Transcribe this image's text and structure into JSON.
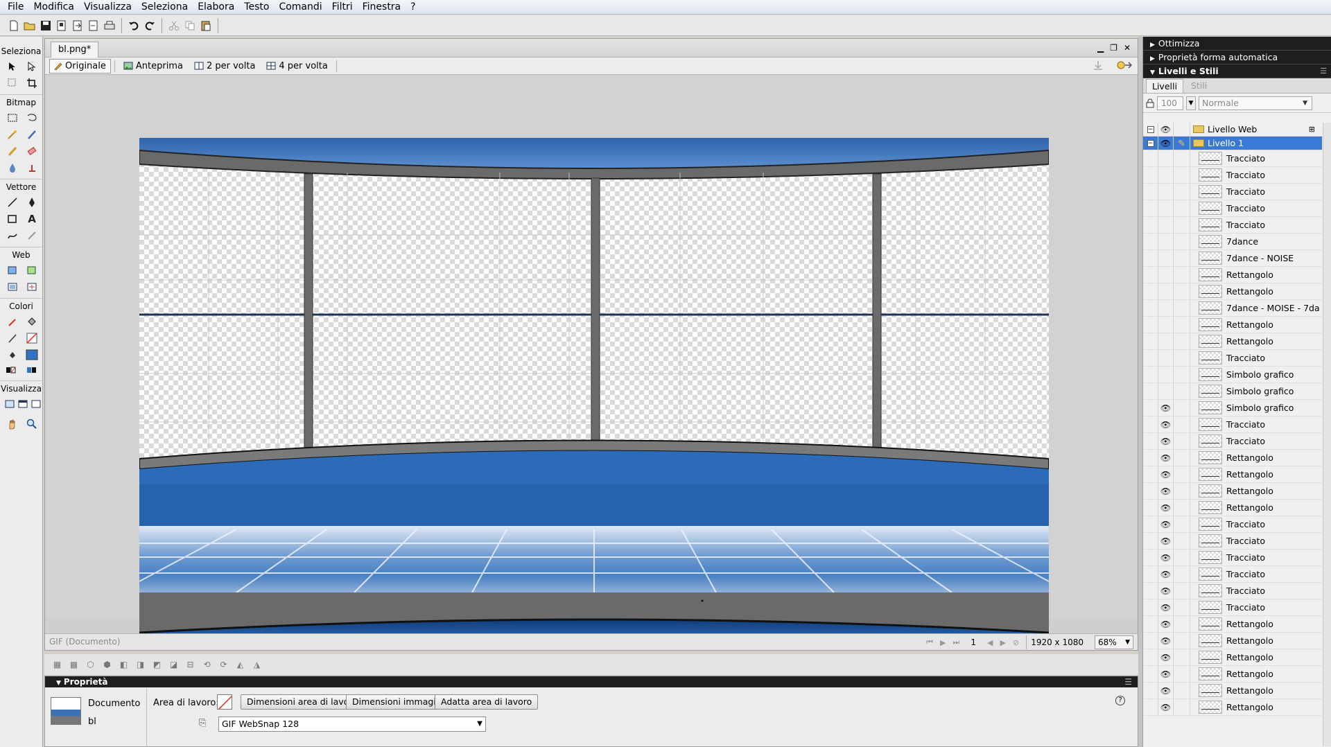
{
  "menu": [
    "File",
    "Modifica",
    "Visualizza",
    "Seleziona",
    "Elabora",
    "Testo",
    "Comandi",
    "Filtri",
    "Finestra",
    "?"
  ],
  "tools": {
    "sections": [
      "Seleziona",
      "Bitmap",
      "Vettore",
      "Web",
      "Colori",
      "Visualizza"
    ]
  },
  "document": {
    "tab_title": "bl.png*",
    "views": [
      "Originale",
      "Anteprima",
      "2 per volta",
      "4 per volta"
    ],
    "status_type": "GIF (Documento)",
    "frame": "1",
    "dimensions": "1920 x 1080",
    "zoom": "68%"
  },
  "properties": {
    "title": "Proprietà",
    "doc_label": "Documento",
    "doc_name": "bl",
    "canvas_label": "Area di lavoro:",
    "btn_canvas_size": "Dimensioni area di lavoro...",
    "btn_image_size": "Dimensioni immagine...",
    "btn_fit": "Adatta area di lavoro",
    "palette": "GIF WebSnap 128"
  },
  "panels": {
    "ottimizza": "Ottimizza",
    "auto_shape": "Proprietà forma automatica",
    "layers_styles": "Livelli e Stili",
    "tab_layers": "Livelli",
    "tab_styles": "Stili",
    "opacity": "100",
    "blend": "Normale"
  },
  "layers": {
    "web_layer": "Livello Web",
    "layer1": "Livello 1",
    "items": [
      {
        "name": "Tracciato",
        "eye": false
      },
      {
        "name": "Tracciato",
        "eye": false
      },
      {
        "name": "Tracciato",
        "eye": false
      },
      {
        "name": "Tracciato",
        "eye": false
      },
      {
        "name": "Tracciato",
        "eye": false
      },
      {
        "name": "7dance",
        "eye": false
      },
      {
        "name": "7dance - NOISE",
        "eye": false
      },
      {
        "name": "Rettangolo",
        "eye": false
      },
      {
        "name": "Rettangolo",
        "eye": false
      },
      {
        "name": "7dance - MOISE - 7da",
        "eye": false
      },
      {
        "name": "Rettangolo",
        "eye": false
      },
      {
        "name": "Rettangolo",
        "eye": false
      },
      {
        "name": "Tracciato",
        "eye": false
      },
      {
        "name": "Simbolo grafico",
        "eye": false
      },
      {
        "name": "Simbolo grafico",
        "eye": false
      },
      {
        "name": "Simbolo grafico",
        "eye": true
      },
      {
        "name": "Tracciato",
        "eye": true
      },
      {
        "name": "Tracciato",
        "eye": true
      },
      {
        "name": "Rettangolo",
        "eye": true
      },
      {
        "name": "Rettangolo",
        "eye": true
      },
      {
        "name": "Rettangolo",
        "eye": true
      },
      {
        "name": "Rettangolo",
        "eye": true
      },
      {
        "name": "Tracciato",
        "eye": true
      },
      {
        "name": "Tracciato",
        "eye": true
      },
      {
        "name": "Tracciato",
        "eye": true
      },
      {
        "name": "Tracciato",
        "eye": true
      },
      {
        "name": "Tracciato",
        "eye": true
      },
      {
        "name": "Tracciato",
        "eye": true
      },
      {
        "name": "Rettangolo",
        "eye": true
      },
      {
        "name": "Rettangolo",
        "eye": true
      },
      {
        "name": "Rettangolo",
        "eye": true
      },
      {
        "name": "Rettangolo",
        "eye": true
      },
      {
        "name": "Rettangolo",
        "eye": true
      },
      {
        "name": "Rettangolo",
        "eye": true
      }
    ]
  }
}
